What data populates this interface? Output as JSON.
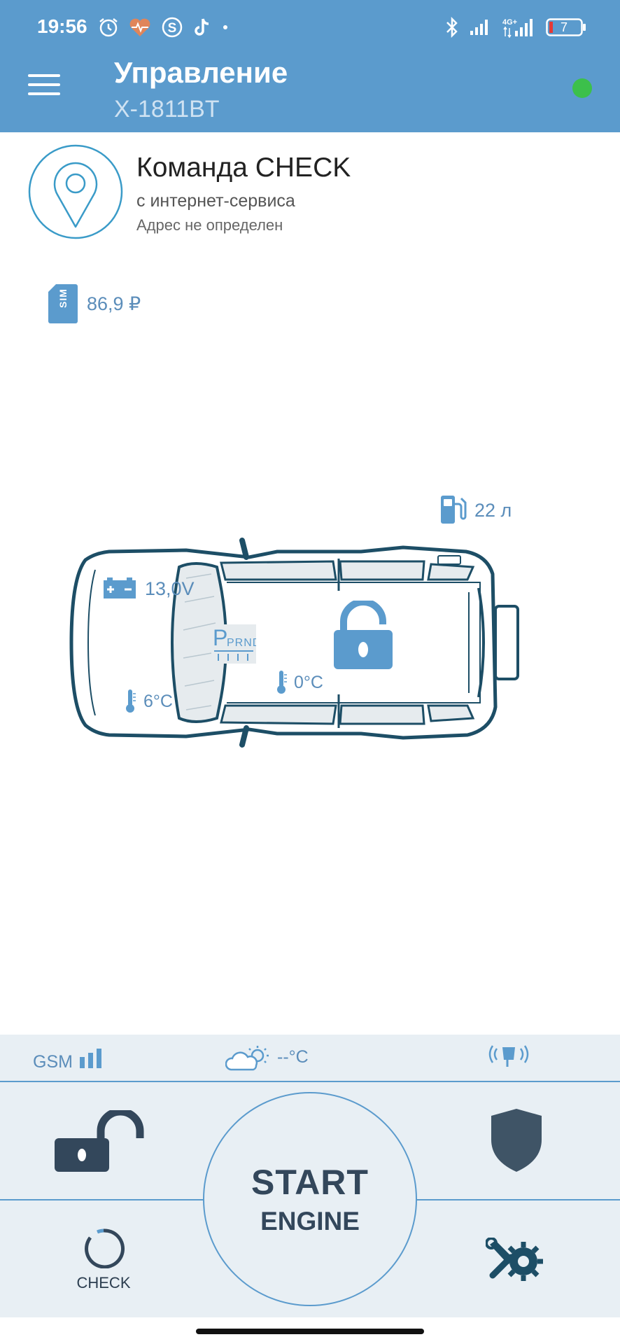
{
  "status_bar": {
    "time": "19:56",
    "battery_level": "7",
    "network": "4G+",
    "icons": [
      "alarm-icon",
      "health-icon",
      "s-app-icon",
      "tiktok-icon",
      "bluetooth-icon",
      "signal-icon",
      "battery-icon"
    ]
  },
  "header": {
    "title": "Управление",
    "device": "X-1811BT",
    "connection_status_color": "#3cc04b",
    "background": "#5b9bcd"
  },
  "command": {
    "title": "Команда CHECK",
    "source": "с интернет-сервиса",
    "address": "Адрес не определен"
  },
  "sim": {
    "icon_label": "SIM",
    "balance": "86,9 ₽"
  },
  "car": {
    "fuel": "22 л",
    "voltage": "13,0V",
    "cabin_temp": "6°C",
    "engine_temp": "0°C",
    "gear_label": "PRND",
    "lock_state": "unlocked"
  },
  "info_strip": {
    "gsm_label": "GSM",
    "weather_value": "--°C"
  },
  "controls": {
    "start_label": "START",
    "engine_label": "ENGINE",
    "check_label": "CHECK"
  }
}
